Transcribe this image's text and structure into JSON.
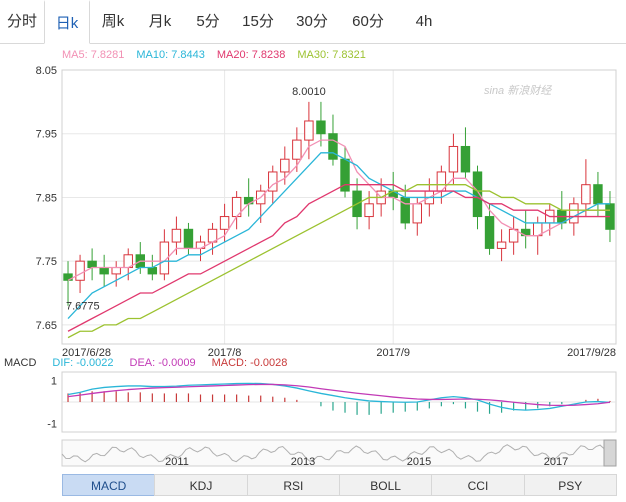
{
  "tabs": [
    {
      "label": "分时",
      "active": false
    },
    {
      "label": "日k",
      "active": true
    },
    {
      "label": "周k",
      "active": false
    },
    {
      "label": "月k",
      "active": false
    },
    {
      "label": "5分",
      "active": false
    },
    {
      "label": "15分",
      "active": false
    },
    {
      "label": "30分",
      "active": false
    },
    {
      "label": "60分",
      "active": false
    },
    {
      "label": "4h",
      "active": false
    }
  ],
  "ma_legend": [
    {
      "label": "MA5: 7.8281",
      "color": "#f290b4"
    },
    {
      "label": "MA10: 7.8443",
      "color": "#2ab6d8"
    },
    {
      "label": "MA20: 7.8238",
      "color": "#e0386e"
    },
    {
      "label": "MA30: 7.8321",
      "color": "#9cc230"
    }
  ],
  "logo_text": "sina 新浪财经",
  "macd_legend": [
    {
      "label": "MACD",
      "color": "#333333"
    },
    {
      "label": "DIF: -0.0022",
      "color": "#2ab6d8"
    },
    {
      "label": "DEA: -0.0009",
      "color": "#c23ab6"
    },
    {
      "label": "MACD: -0.0028",
      "color": "#c83a3a"
    }
  ],
  "indicators": [
    {
      "label": "MACD",
      "active": true
    },
    {
      "label": "KDJ",
      "active": false
    },
    {
      "label": "RSI",
      "active": false
    },
    {
      "label": "BOLL",
      "active": false
    },
    {
      "label": "CCI",
      "active": false
    },
    {
      "label": "PSY",
      "active": false
    }
  ],
  "overview_labels": [
    "2011",
    "2013",
    "2015",
    "2017"
  ],
  "chart_data": {
    "type": "candlestick",
    "ylim": [
      7.62,
      8.05
    ],
    "y_ticks": [
      "8.05",
      "7.95",
      "7.85",
      "7.75",
      "7.65"
    ],
    "x_tick_labels": [
      "2017/6/28",
      "2017/8",
      "2017/9",
      "2017/9/28"
    ],
    "annotations": {
      "high": "8.0010",
      "low": "7.6775"
    },
    "ohlc": [
      [
        7.73,
        7.75,
        7.68,
        7.72
      ],
      [
        7.72,
        7.76,
        7.7,
        7.75
      ],
      [
        7.75,
        7.77,
        7.72,
        7.74
      ],
      [
        7.74,
        7.76,
        7.71,
        7.73
      ],
      [
        7.73,
        7.75,
        7.71,
        7.74
      ],
      [
        7.74,
        7.77,
        7.72,
        7.76
      ],
      [
        7.76,
        7.78,
        7.73,
        7.74
      ],
      [
        7.74,
        7.76,
        7.72,
        7.73
      ],
      [
        7.73,
        7.8,
        7.72,
        7.78
      ],
      [
        7.78,
        7.82,
        7.76,
        7.8
      ],
      [
        7.8,
        7.81,
        7.76,
        7.77
      ],
      [
        7.77,
        7.79,
        7.75,
        7.78
      ],
      [
        7.78,
        7.81,
        7.76,
        7.8
      ],
      [
        7.8,
        7.84,
        7.78,
        7.82
      ],
      [
        7.82,
        7.86,
        7.8,
        7.85
      ],
      [
        7.85,
        7.88,
        7.82,
        7.84
      ],
      [
        7.84,
        7.87,
        7.81,
        7.86
      ],
      [
        7.86,
        7.9,
        7.84,
        7.89
      ],
      [
        7.89,
        7.93,
        7.87,
        7.91
      ],
      [
        7.91,
        7.96,
        7.89,
        7.94
      ],
      [
        7.94,
        8.0,
        7.91,
        7.97
      ],
      [
        7.97,
        8.0,
        7.93,
        7.95
      ],
      [
        7.95,
        7.98,
        7.9,
        7.91
      ],
      [
        7.91,
        7.93,
        7.85,
        7.86
      ],
      [
        7.86,
        7.88,
        7.8,
        7.82
      ],
      [
        7.82,
        7.86,
        7.8,
        7.84
      ],
      [
        7.84,
        7.88,
        7.82,
        7.86
      ],
      [
        7.86,
        7.89,
        7.83,
        7.85
      ],
      [
        7.85,
        7.87,
        7.8,
        7.81
      ],
      [
        7.81,
        7.85,
        7.79,
        7.84
      ],
      [
        7.84,
        7.88,
        7.82,
        7.86
      ],
      [
        7.86,
        7.9,
        7.84,
        7.89
      ],
      [
        7.89,
        7.95,
        7.87,
        7.93
      ],
      [
        7.93,
        7.96,
        7.88,
        7.89
      ],
      [
        7.89,
        7.9,
        7.8,
        7.82
      ],
      [
        7.82,
        7.84,
        7.76,
        7.77
      ],
      [
        7.77,
        7.8,
        7.75,
        7.78
      ],
      [
        7.78,
        7.82,
        7.76,
        7.8
      ],
      [
        7.8,
        7.83,
        7.77,
        7.79
      ],
      [
        7.79,
        7.82,
        7.76,
        7.81
      ],
      [
        7.81,
        7.84,
        7.79,
        7.83
      ],
      [
        7.83,
        7.86,
        7.8,
        7.81
      ],
      [
        7.81,
        7.85,
        7.79,
        7.84
      ],
      [
        7.84,
        7.91,
        7.82,
        7.87
      ],
      [
        7.87,
        7.89,
        7.82,
        7.84
      ],
      [
        7.84,
        7.86,
        7.78,
        7.8
      ]
    ],
    "ma5": [
      7.72,
      7.73,
      7.74,
      7.74,
      7.74,
      7.74,
      7.75,
      7.75,
      7.75,
      7.77,
      7.77,
      7.77,
      7.78,
      7.79,
      7.82,
      7.84,
      7.85,
      7.87,
      7.88,
      7.9,
      7.93,
      7.94,
      7.94,
      7.93,
      7.89,
      7.87,
      7.85,
      7.85,
      7.84,
      7.84,
      7.85,
      7.86,
      7.88,
      7.88,
      7.86,
      7.83,
      7.81,
      7.8,
      7.79,
      7.79,
      7.8,
      7.81,
      7.82,
      7.83,
      7.83,
      7.83
    ],
    "ma10": [
      7.66,
      7.68,
      7.7,
      7.71,
      7.72,
      7.73,
      7.74,
      7.74,
      7.75,
      7.75,
      7.76,
      7.76,
      7.77,
      7.78,
      7.79,
      7.8,
      7.82,
      7.84,
      7.86,
      7.88,
      7.9,
      7.92,
      7.92,
      7.91,
      7.9,
      7.88,
      7.87,
      7.86,
      7.85,
      7.85,
      7.85,
      7.85,
      7.86,
      7.86,
      7.85,
      7.84,
      7.83,
      7.82,
      7.81,
      7.81,
      7.81,
      7.81,
      7.82,
      7.83,
      7.84,
      7.84
    ],
    "ma20": [
      7.64,
      7.65,
      7.66,
      7.67,
      7.68,
      7.69,
      7.7,
      7.7,
      7.71,
      7.72,
      7.73,
      7.73,
      7.74,
      7.75,
      7.76,
      7.77,
      7.78,
      7.79,
      7.81,
      7.82,
      7.84,
      7.85,
      7.86,
      7.87,
      7.87,
      7.87,
      7.87,
      7.87,
      7.86,
      7.86,
      7.86,
      7.86,
      7.86,
      7.85,
      7.85,
      7.84,
      7.84,
      7.83,
      7.83,
      7.83,
      7.82,
      7.82,
      7.82,
      7.82,
      7.82,
      7.82
    ],
    "ma30": [
      7.63,
      7.64,
      7.64,
      7.65,
      7.65,
      7.66,
      7.66,
      7.67,
      7.68,
      7.69,
      7.7,
      7.71,
      7.72,
      7.73,
      7.74,
      7.75,
      7.76,
      7.77,
      7.78,
      7.79,
      7.8,
      7.81,
      7.82,
      7.83,
      7.84,
      7.85,
      7.85,
      7.86,
      7.86,
      7.87,
      7.87,
      7.87,
      7.87,
      7.87,
      7.86,
      7.86,
      7.85,
      7.85,
      7.84,
      7.84,
      7.84,
      7.83,
      7.83,
      7.83,
      7.83,
      7.83
    ],
    "macd_ylim": [
      -1.4,
      1.4
    ],
    "macd_y_ticks": [
      "1",
      "-1"
    ],
    "macd_hist": [
      0.4,
      0.45,
      0.5,
      0.5,
      0.5,
      0.45,
      0.45,
      0.4,
      0.4,
      0.4,
      0.4,
      0.35,
      0.35,
      0.35,
      0.35,
      0.3,
      0.3,
      0.25,
      0.2,
      0.1,
      0.0,
      -0.2,
      -0.4,
      -0.5,
      -0.6,
      -0.6,
      -0.55,
      -0.5,
      -0.45,
      -0.4,
      -0.3,
      -0.2,
      -0.1,
      -0.3,
      -0.45,
      -0.55,
      -0.5,
      -0.4,
      -0.35,
      -0.3,
      -0.2,
      -0.1,
      0.0,
      0.1,
      0.15,
      0.05
    ],
    "dif": [
      0.35,
      0.45,
      0.6,
      0.68,
      0.72,
      0.75,
      0.75,
      0.72,
      0.72,
      0.74,
      0.78,
      0.8,
      0.82,
      0.84,
      0.86,
      0.87,
      0.86,
      0.82,
      0.75,
      0.65,
      0.52,
      0.4,
      0.3,
      0.2,
      0.12,
      0.05,
      0.02,
      0.0,
      -0.01,
      0.0,
      0.1,
      0.2,
      0.25,
      0.2,
      0.1,
      -0.1,
      -0.25,
      -0.35,
      -0.38,
      -0.35,
      -0.3,
      -0.2,
      -0.1,
      0.0,
      0.02,
      -0.02
    ],
    "dea": [
      0.25,
      0.32,
      0.4,
      0.47,
      0.53,
      0.58,
      0.62,
      0.65,
      0.67,
      0.69,
      0.71,
      0.73,
      0.75,
      0.77,
      0.79,
      0.81,
      0.82,
      0.82,
      0.8,
      0.76,
      0.7,
      0.62,
      0.55,
      0.48,
      0.41,
      0.35,
      0.29,
      0.23,
      0.18,
      0.14,
      0.12,
      0.12,
      0.13,
      0.14,
      0.13,
      0.1,
      0.05,
      -0.01,
      -0.07,
      -0.12,
      -0.15,
      -0.16,
      -0.15,
      -0.12,
      -0.08,
      -0.01
    ]
  }
}
